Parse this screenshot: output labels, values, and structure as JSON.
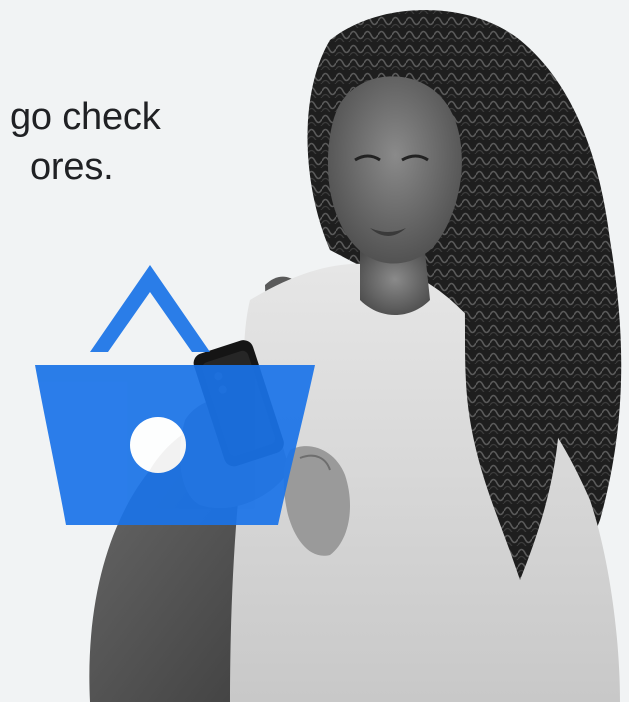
{
  "headline": {
    "line1": "go check",
    "line2": "ores."
  },
  "photo": {
    "icon": "shopping-basket-icon"
  },
  "colors": {
    "background": "#f1f3f4",
    "accent": "#1a73e8",
    "text": "#202124"
  }
}
